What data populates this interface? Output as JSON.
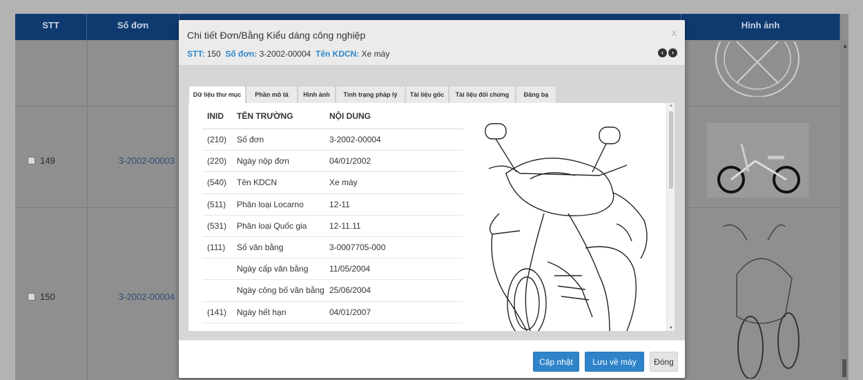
{
  "grid": {
    "columns": [
      "STT",
      "Số đơn",
      "Hình ảnh"
    ],
    "rows": [
      {
        "stt": "149",
        "so_don": "3-2002-00003"
      },
      {
        "stt": "150",
        "so_don": "3-2002-00004"
      }
    ]
  },
  "modal": {
    "title": "Chi tiết Đơn/Bằng Kiểu dáng công nghiệp",
    "close": "x",
    "sub": {
      "stt_label": "STT:",
      "stt_value": "150",
      "sodon_label": "Số đơn:",
      "sodon_value": "3-2002-00004",
      "tenkdcn_label": "Tên KDCN:",
      "tenkdcn_value": "Xe máy"
    },
    "tabs": [
      "Dữ liệu thư mục",
      "Phần mô tả",
      "Hình ảnh",
      "Tình trạng pháp lý",
      "Tài liệu gốc",
      "Tài liệu đối chứng",
      "Đăng bạ"
    ],
    "table": {
      "headers": [
        "INID",
        "TÊN TRƯỜNG",
        "NỘI DUNG"
      ],
      "rows": [
        [
          "(210)",
          "Số đơn",
          "3-2002-00004"
        ],
        [
          "(220)",
          "Ngày nộp đơn",
          "04/01/2002"
        ],
        [
          "(540)",
          "Tên KDCN",
          "Xe máy"
        ],
        [
          "(511)",
          "Phân loại Locarno",
          "12-11"
        ],
        [
          "(531)",
          "Phân loại Quốc gia",
          "12-11.11"
        ],
        [
          "(111)",
          "Số văn bằng",
          "3-0007705-000"
        ],
        [
          "",
          "Ngày cấp văn bằng",
          "11/05/2004"
        ],
        [
          "",
          "Ngày công bố văn bằng",
          "25/06/2004"
        ],
        [
          "(141)",
          "Ngày hết hạn",
          "04/01/2007"
        ]
      ]
    },
    "buttons": {
      "update": "Cập nhật",
      "save": "Lưu về máy",
      "close": "Đóng"
    }
  },
  "colors": {
    "header_bg": "#0f3a6f",
    "accent": "#2f84c9",
    "label_blue": "#2f86c9"
  }
}
